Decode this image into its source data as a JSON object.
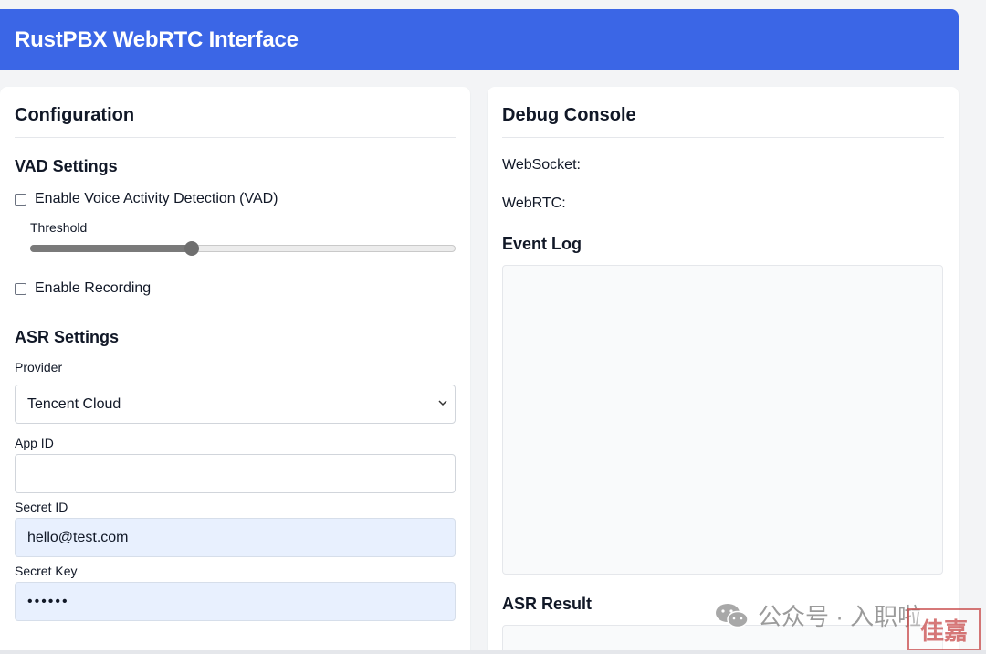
{
  "header": {
    "title": "RustPBX WebRTC Interface"
  },
  "config": {
    "title": "Configuration",
    "vad": {
      "heading": "VAD Settings",
      "enable_label": "Enable Voice Activity Detection (VAD)",
      "threshold_label": "Threshold",
      "threshold_value": 0.38
    },
    "recording_label": "Enable Recording",
    "asr": {
      "heading": "ASR Settings",
      "provider_label": "Provider",
      "provider_value": "Tencent Cloud",
      "app_id_label": "App ID",
      "app_id_value": "",
      "secret_id_label": "Secret ID",
      "secret_id_value": "hello@test.com",
      "secret_key_label": "Secret Key",
      "secret_key_value": "••••••"
    }
  },
  "debug": {
    "title": "Debug Console",
    "websocket_label": "WebSocket:",
    "webrtc_label": "WebRTC:",
    "event_log_heading": "Event Log",
    "asr_result_heading": "ASR Result"
  },
  "watermark": {
    "text": "公众号 · 入职啦",
    "stamp": "佳嘉"
  },
  "colors": {
    "accent": "#3b66e6",
    "autofill": "#e8f0fe"
  }
}
